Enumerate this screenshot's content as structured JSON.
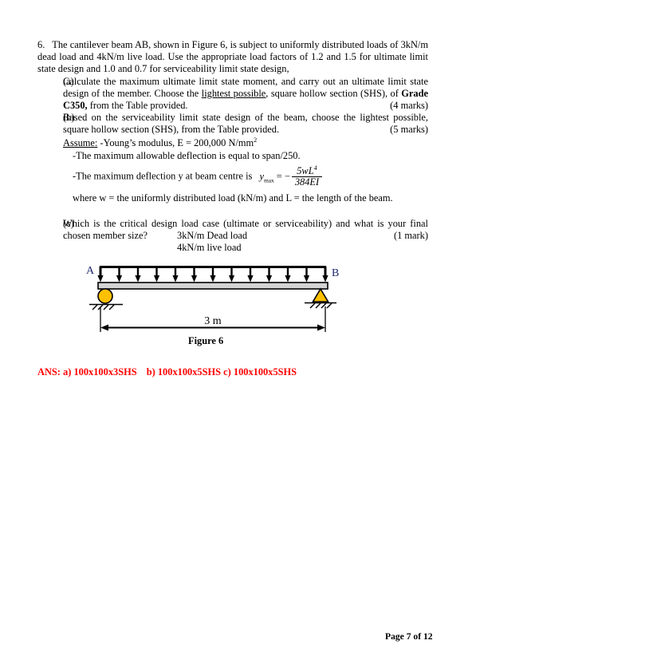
{
  "document": {
    "question_number": "6.",
    "intro": "The cantilever beam AB, shown in Figure 6, is subject to uniformly distributed loads of 3kN/m dead load and 4kN/m live load.  Use the appropriate load factors of 1.2 and 1.5 for ultimate limit state design and 1.0 and 0.7 for serviceability limit state design,",
    "parts": [
      {
        "tag": "(a)",
        "text_1": "Calculate the maximum ultimate limit state moment, and carry out an ultimate limit state design of the member.  Choose the ",
        "emphasis": "lightest possible",
        "text_2": ", square hollow section (SHS), of ",
        "bold_1": "Grade C350,",
        "text_3": " from the Table provided.",
        "marks": "(4 marks)"
      },
      {
        "tag": "(b)",
        "text_1": "Based on the serviceability limit state design of the beam, choose the lightest possible, square hollow section (SHS), from the Table provided.",
        "marks": "(5 marks)"
      },
      {
        "tag": "(c)",
        "text_1": "Which is the critical design load case (ultimate or serviceability) and what is your final chosen member size?",
        "marks": "(1 mark)"
      }
    ],
    "assume": {
      "label": "Assume:",
      "youngs_modulus": "-Young’s modulus, E = 200,000 N/mm",
      "youngs_modulus_sup": "2",
      "deflection_limit": "-The maximum allowable deflection is equal to span/250.",
      "deflection_text": "-The maximum deflection y at beam centre is",
      "formula": {
        "lhs": "y",
        "lhs_sub": "max",
        "equals": "= −",
        "numerator": "5wL",
        "numerator_sup": "4",
        "denominator": "384EI"
      },
      "where_line": "where w = the uniformly distributed load (kN/m) and L = the length of the beam."
    },
    "figure": {
      "load_line_1": "3kN/m Dead load",
      "load_line_2": "4kN/m live load",
      "label_a": "A",
      "label_b": "B",
      "span_label": "3 m",
      "caption": "Figure 6",
      "arrow_count": 12,
      "support_color": "#FFC000",
      "beam_color": "#D4D4D4",
      "label_color": "#1F2A6E"
    },
    "answer": {
      "prefix": "ANS:",
      "a": "a) 100x100x3SHS",
      "b": "b) 100x100x5SHS",
      "c": "c) 100x100x5SHS",
      "color": "#FF0000"
    },
    "footer": "Page 7 of 12"
  }
}
